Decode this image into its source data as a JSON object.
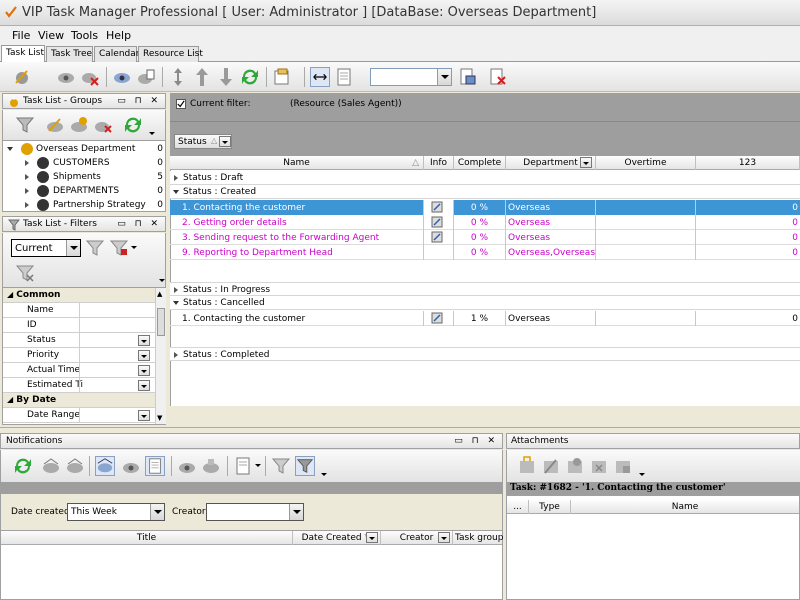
{
  "window": {
    "title": "VIP Task Manager Professional [ User: Administrator ] [DataBase: Overseas Department]"
  },
  "menu": [
    "File",
    "View",
    "Tools",
    "Help"
  ],
  "tabs": [
    "Task List",
    "Task Tree",
    "Calendar",
    "Resource List"
  ],
  "groups_panel": {
    "title": "Task List - Groups",
    "tree": [
      {
        "label": "Overseas Department",
        "count": "0"
      },
      {
        "label": "CUSTOMERS",
        "count": "0"
      },
      {
        "label": "Shipments",
        "count": "5"
      },
      {
        "label": "DEPARTMENTS",
        "count": "0"
      },
      {
        "label": "Partnership Strategy",
        "count": "0"
      }
    ]
  },
  "filters_panel": {
    "title": "Task List - Filters",
    "current_value": "Current",
    "sections": [
      {
        "label": "Common",
        "items": [
          "Name",
          "ID",
          "Status",
          "Priority",
          "Actual Time",
          "Estimated Ti"
        ]
      },
      {
        "label": "By Date",
        "items": [
          "Date Range"
        ]
      }
    ]
  },
  "filter_bar": {
    "label": "Current filter:",
    "value": "(Resource  (Sales Agent))"
  },
  "group_by": {
    "label": "Status"
  },
  "grid": {
    "columns": [
      "Name",
      "Info",
      "Complete",
      "Department",
      "Overtime",
      "123"
    ],
    "groups": [
      {
        "label": "Status : Draft",
        "rows": []
      },
      {
        "label": "Status : Created",
        "rows": [
          {
            "name": "1. Contacting the customer",
            "complete": "0 %",
            "department": "Overseas",
            "last": "0"
          },
          {
            "name": "2. Getting order details",
            "complete": "0 %",
            "department": "Overseas",
            "last": "0"
          },
          {
            "name": "3. Sending request to the Forwarding Agent",
            "complete": "0 %",
            "department": "Overseas",
            "last": "0"
          },
          {
            "name": "9. Reporting to Department Head",
            "complete": "0 %",
            "department": "Overseas,Overseas,C",
            "last": "0"
          }
        ]
      },
      {
        "label": "Status : In Progress",
        "rows": []
      },
      {
        "label": "Status : Cancelled",
        "rows": [
          {
            "name": "1. Contacting the customer",
            "complete": "1 %",
            "department": "Overseas",
            "last": "0"
          }
        ]
      },
      {
        "label": "Status : Completed",
        "rows": []
      }
    ]
  },
  "notifications": {
    "title": "Notifications",
    "date_created_label": "Date created:",
    "date_created_value": "This Week",
    "creator_label": "Creator:",
    "creator_value": "",
    "columns": [
      "Title",
      "Date Created",
      "Creator",
      "Task group"
    ]
  },
  "attachments": {
    "title": "Attachments",
    "task_header": "Task: #1682 - '1. Contacting the customer'",
    "columns": [
      "...",
      "Type",
      "Name"
    ]
  },
  "colors": {
    "selected_row": "#3d95d6",
    "magenta_text": "#cc00cc",
    "status_gray": "#9e9e9e"
  }
}
